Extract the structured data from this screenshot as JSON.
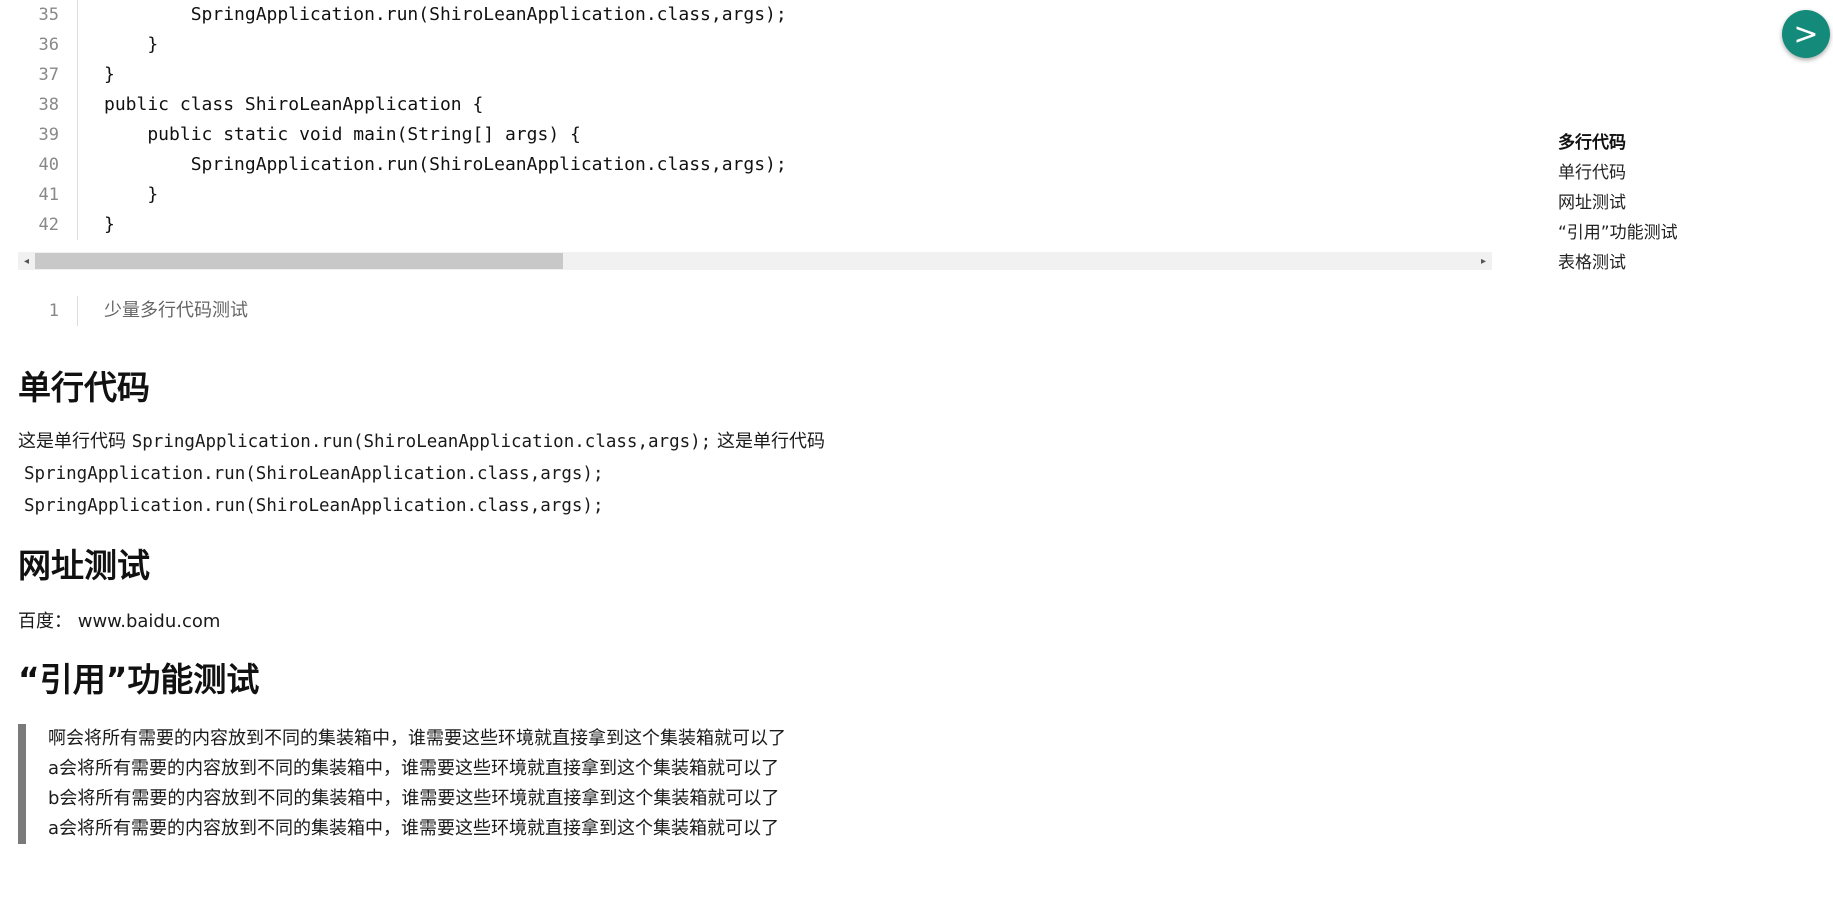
{
  "code_block": {
    "lines": [
      {
        "num": "35",
        "code": "        SpringApplication.run(ShiroLeanApplication.class,args);"
      },
      {
        "num": "36",
        "code": "    }"
      },
      {
        "num": "37",
        "code": "}"
      },
      {
        "num": "38",
        "code": "public class ShiroLeanApplication {"
      },
      {
        "num": "39",
        "code": "    public static void main(String[] args) {"
      },
      {
        "num": "40",
        "code": "        SpringApplication.run(ShiroLeanApplication.class,args);"
      },
      {
        "num": "41",
        "code": "    }"
      },
      {
        "num": "42",
        "code": "}"
      }
    ]
  },
  "code_block2": {
    "lines": [
      {
        "num": "1",
        "code": "少量多行代码测试"
      }
    ]
  },
  "sections": {
    "single_line": {
      "title": "单行代码",
      "text_prefix": "这是单行代码 ",
      "inline_code": "SpringApplication.run(ShiroLeanApplication.class,args);",
      "text_suffix": " 这是单行代码",
      "code_line_1": "SpringApplication.run(ShiroLeanApplication.class,args);",
      "code_line_2": "SpringApplication.run(ShiroLeanApplication.class,args);"
    },
    "url": {
      "title": "网址测试",
      "label": "百度：",
      "link": "www.baidu.com"
    },
    "quote": {
      "title": "“引用”功能测试",
      "lines": [
        "啊会将所有需要的内容放到不同的集装箱中，谁需要这些环境就直接拿到这个集装箱就可以了",
        "a会将所有需要的内容放到不同的集装箱中，谁需要这些环境就直接拿到这个集装箱就可以了",
        "b会将所有需要的内容放到不同的集装箱中，谁需要这些环境就直接拿到这个集装箱就可以了",
        "a会将所有需要的内容放到不同的集装箱中，谁需要这些环境就直接拿到这个集装箱就可以了"
      ]
    }
  },
  "toc": {
    "items": [
      {
        "label": "多行代码",
        "active": true
      },
      {
        "label": "单行代码",
        "active": false
      },
      {
        "label": "网址测试",
        "active": false
      },
      {
        "label": "“引用”功能测试",
        "active": false
      },
      {
        "label": "表格测试",
        "active": false
      }
    ]
  },
  "fab": {
    "icon": "chevron-right-icon",
    "glyph": ">",
    "color": "#138a7a"
  },
  "scrollbar": {
    "left_arrow": "◂",
    "right_arrow": "▸"
  }
}
